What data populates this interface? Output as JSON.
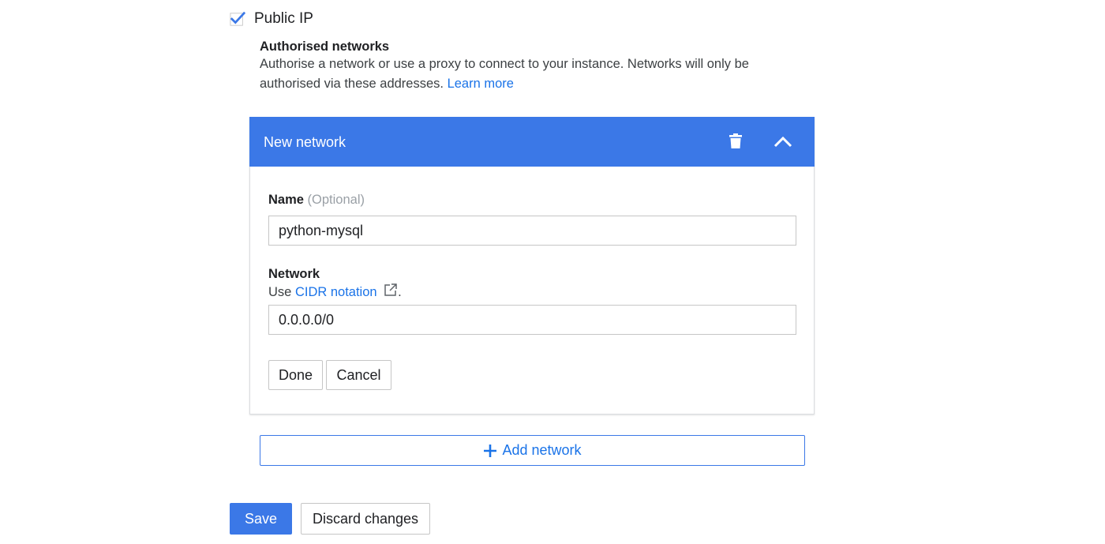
{
  "public_ip": {
    "label": "Public IP",
    "checked": true
  },
  "authorised_networks": {
    "title": "Authorised networks",
    "description": "Authorise a network or use a proxy to connect to your instance. Networks will only be authorised via these addresses.",
    "learn_more": "Learn more"
  },
  "network_card": {
    "header_title": "New network",
    "name_label": "Name",
    "name_optional": "(Optional)",
    "name_value": "python-mysql",
    "network_label": "Network",
    "network_helper_prefix": "Use",
    "network_helper_link": "CIDR notation",
    "network_helper_suffix": ".",
    "network_value": "0.0.0.0/0",
    "done_label": "Done",
    "cancel_label": "Cancel"
  },
  "add_network_label": "Add network",
  "footer": {
    "save_label": "Save",
    "discard_label": "Discard changes"
  },
  "colors": {
    "primary": "#3b78e7",
    "link": "#1a73e8",
    "header_bg": "#3b78e7"
  },
  "icons": {
    "checkbox": "check-icon",
    "delete": "trash-icon",
    "collapse": "chevron-up-icon",
    "external": "external-link-icon",
    "add": "plus-icon"
  }
}
